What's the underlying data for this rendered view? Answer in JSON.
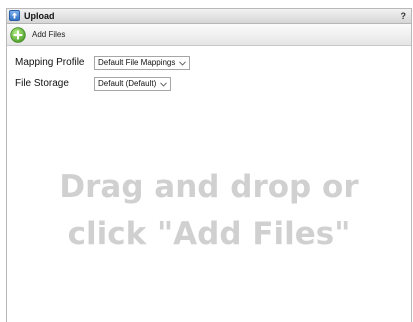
{
  "window": {
    "title": "Upload",
    "help_label": "?"
  },
  "toolbar": {
    "add_files_label": "Add Files"
  },
  "form": {
    "mapping_profile": {
      "label": "Mapping Profile",
      "value": "Default File Mappings"
    },
    "file_storage": {
      "label": "File Storage",
      "value": "Default (Default)"
    }
  },
  "dropzone": {
    "line1": "Drag and drop or",
    "line2": "click \"Add Files\""
  },
  "colors": {
    "accent_green": "#5db33a",
    "title_icon_blue": "#2f6fc4",
    "hint_gray": "#d0d0d0"
  },
  "icons": [
    "upload-icon",
    "add-icon",
    "chevron-down-icon"
  ]
}
